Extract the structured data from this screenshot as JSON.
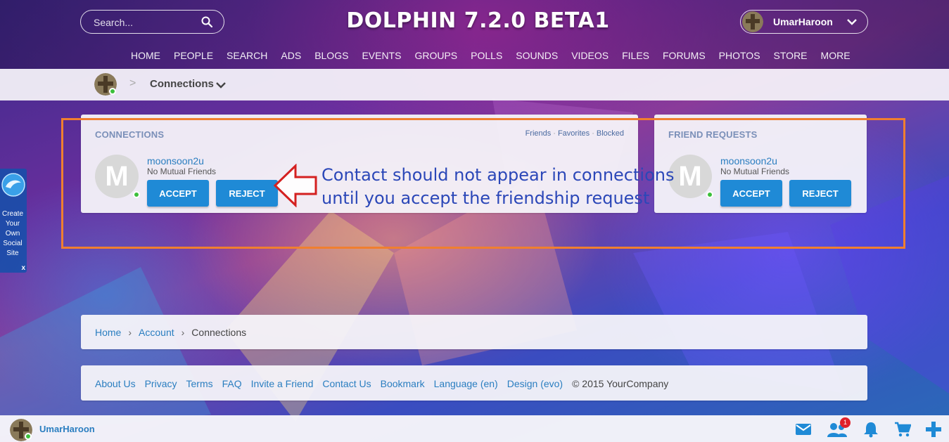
{
  "header": {
    "search_placeholder": "Search...",
    "site_title": "DOLPHIN 7.2.0 BETA1",
    "user_name": "UmarHaroon",
    "nav": [
      "HOME",
      "PEOPLE",
      "SEARCH",
      "ADS",
      "BLOGS",
      "EVENTS",
      "GROUPS",
      "POLLS",
      "SOUNDS",
      "VIDEOS",
      "FILES",
      "FORUMS",
      "PHOTOS",
      "STORE",
      "MORE"
    ]
  },
  "subbar": {
    "sep": ">",
    "title": "Connections"
  },
  "connections": {
    "title": "CONNECTIONS",
    "filters": [
      "Friends",
      "Favorites",
      "Blocked"
    ],
    "user": {
      "initial": "M",
      "name": "moonsoon2u",
      "sub": "No Mutual Friends"
    },
    "accept_label": "ACCEPT",
    "reject_label": "REJECT"
  },
  "friend_requests": {
    "title": "FRIEND REQUESTS",
    "user": {
      "initial": "M",
      "name": "moonsoon2u",
      "sub": "No Mutual Friends"
    },
    "accept_label": "ACCEPT",
    "reject_label": "REJECT"
  },
  "annotation": {
    "line1": "Contact should not appear in connections",
    "line2": "until you accept the friendship request",
    "color": "#f07f2f"
  },
  "side_widget": {
    "text": [
      "Create",
      "Your",
      "Own",
      "Social",
      "Site"
    ],
    "close": "x"
  },
  "breadcrumb": {
    "home": "Home",
    "account": "Account",
    "current": "Connections",
    "sep": "›"
  },
  "footer": {
    "links": [
      "About Us",
      "Privacy",
      "Terms",
      "FAQ",
      "Invite a Friend",
      "Contact Us",
      "Bookmark",
      "Language (en)",
      "Design (evo)"
    ],
    "copyright": "© 2015 YourCompany"
  },
  "bottombar": {
    "user_name": "UmarHaroon",
    "friends_badge": "1",
    "icons": [
      "mail-icon",
      "friends-icon",
      "bell-icon",
      "cart-icon",
      "plus-icon"
    ]
  },
  "colors": {
    "accent": "#1f8ad6",
    "link": "#2a7ec0",
    "online": "#3cbf3c"
  }
}
